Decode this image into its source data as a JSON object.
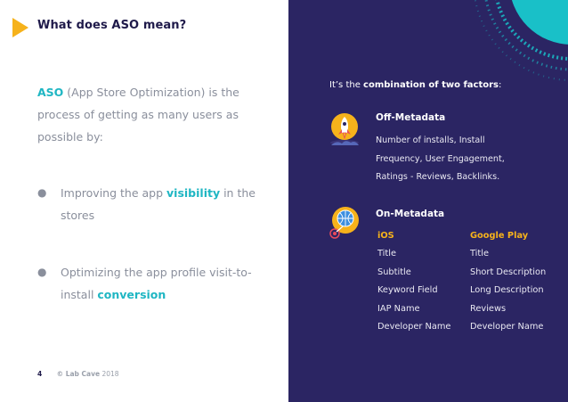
{
  "colors": {
    "accent_teal": "#1fb6c3",
    "accent_yellow": "#f6b21b",
    "panel_bg": "#2b2563",
    "title_color": "#1f1a4a"
  },
  "left": {
    "title": "What does ASO mean?",
    "intro": {
      "highlight": "ASO",
      "rest": " (App Store Optimization) is the process of getting as many users as possible by:"
    },
    "bullets": [
      {
        "pre": "Improving the app ",
        "highlight": "visibility",
        "post": " in the stores"
      },
      {
        "pre": "Optimizing the app profile visit-to-install ",
        "highlight": "conversion",
        "post": ""
      }
    ],
    "footer": {
      "page": "4",
      "brand": "© Lab Cave",
      "year": "2018"
    }
  },
  "right": {
    "combo_pre": "It’s the ",
    "combo_bold": "combination of two factors",
    "combo_post": ":",
    "off_metadata": {
      "title": "Off-Metadata",
      "icon": "rocket-icon",
      "lines": [
        "Number of installs, Install",
        "Frequency, User Engagement,",
        "Ratings - Reviews, Backlinks."
      ]
    },
    "on_metadata": {
      "title": "On-Metadata",
      "icon": "globe-target-icon",
      "ios": {
        "header": "iOS",
        "items": [
          "Title",
          "Subtitle",
          "Keyword Field",
          "IAP Name",
          "Developer Name"
        ]
      },
      "google_play": {
        "header": "Google Play",
        "items": [
          "Title",
          "Short Description",
          "Long Description",
          "Reviews",
          "Developer Name"
        ]
      }
    }
  }
}
